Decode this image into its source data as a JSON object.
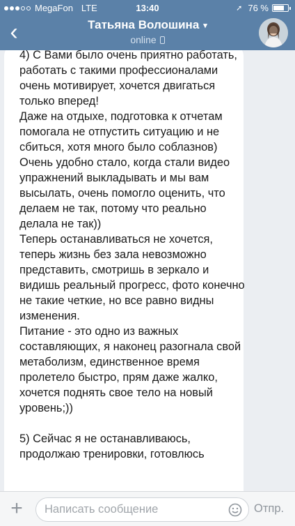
{
  "status_bar": {
    "carrier": "MegaFon",
    "network": "LTE",
    "time": "13:40",
    "battery_percent": "76 %",
    "battery_level": 0.76,
    "signal_bars_filled": 3,
    "signal_bars_total": 5
  },
  "header": {
    "contact_name": "Татьяна Волошина",
    "status": "online",
    "background_color": "#5b81a8"
  },
  "message": {
    "text": "4) С Вами было очень приятно работать, работать с такими профессионалами очень мотивирует, хочется двигаться только вперед!\nДаже на отдыхе, подготовка к отчетам помогала не отпустить ситуацию и не сбиться, хотя много было соблазнов)\nОчень удобно стало, когда стали видео упражнений выкладывать и мы вам высылать, очень помогло оценить, что делаем не так, потому что реально делала не так))\nТеперь останавливаться не хочется, теперь жизнь без зала невозможно представить, смотришь в зеркало и видишь реальный прогресс, фото конечно не такие четкие, но все равно видны изменения.\nПитание - это одно из важных составляющих, я наконец разогнала свой метаболизм, единственное время пролетело быстро, прям даже жалко, хочется поднять свое тело на новый уровень;))\n\n5) Сейчас я не останавливаюсь, продолжаю тренировки, готовлюсь"
  },
  "composer": {
    "placeholder": "Написать сообщение",
    "send_label": "Отпр."
  }
}
